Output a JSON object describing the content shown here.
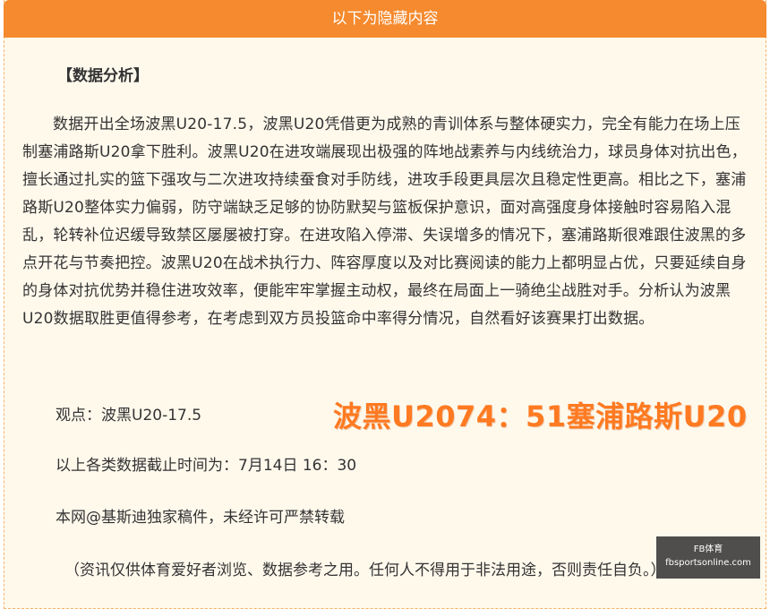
{
  "header": {
    "title": "以下为隐藏内容"
  },
  "content": {
    "section_title": "【数据分析】",
    "paragraph": "数据开出全场波黑U20-17.5，波黑U20凭借更为成熟的青训体系与整体硬实力，完全有能力在场上压制塞浦路斯U20拿下胜利。波黑U20在进攻端展现出极强的阵地战素养与内线统治力，球员身体对抗出色，擅长通过扎实的篮下强攻与二次进攻持续蚕食对手防线，进攻手段更具层次且稳定性更高。相比之下，塞浦路斯U20整体实力偏弱，防守端缺乏足够的协防默契与篮板保护意识，面对高强度身体接触时容易陷入混乱，轮转补位迟缓导致禁区屡屡被打穿。在进攻陷入停滞、失误增多的情况下，塞浦路斯很难跟住波黑的多点开花与节奏把控。波黑U20在战术执行力、阵容厚度以及对比赛阅读的能力上都明显占优，只要延续自身的身体对抗优势并稳住进攻效率，便能牢牢掌握主动权，最终在局面上一骑绝尘战胜对手。分析认为波黑U20数据取胜更值得参考，在考虑到双方员投篮命中率得分情况，自然看好该赛果打出数据。",
    "viewpoint": "观点：波黑U20-17.5",
    "score_overlay": "波黑U2074：51塞浦路斯U20",
    "cutoff_time": "以上各类数据截止时间为：7月14日 16：30",
    "copyright": "本网@基斯迪独家稿件，未经许可严禁转载",
    "disclaimer": "（资讯仅供体育爱好者浏览、数据参考之用。任何人不得用于非法用途，否则责任自负。）"
  },
  "watermark": {
    "title": "FB体育",
    "url": "fbsportsonline.com"
  }
}
